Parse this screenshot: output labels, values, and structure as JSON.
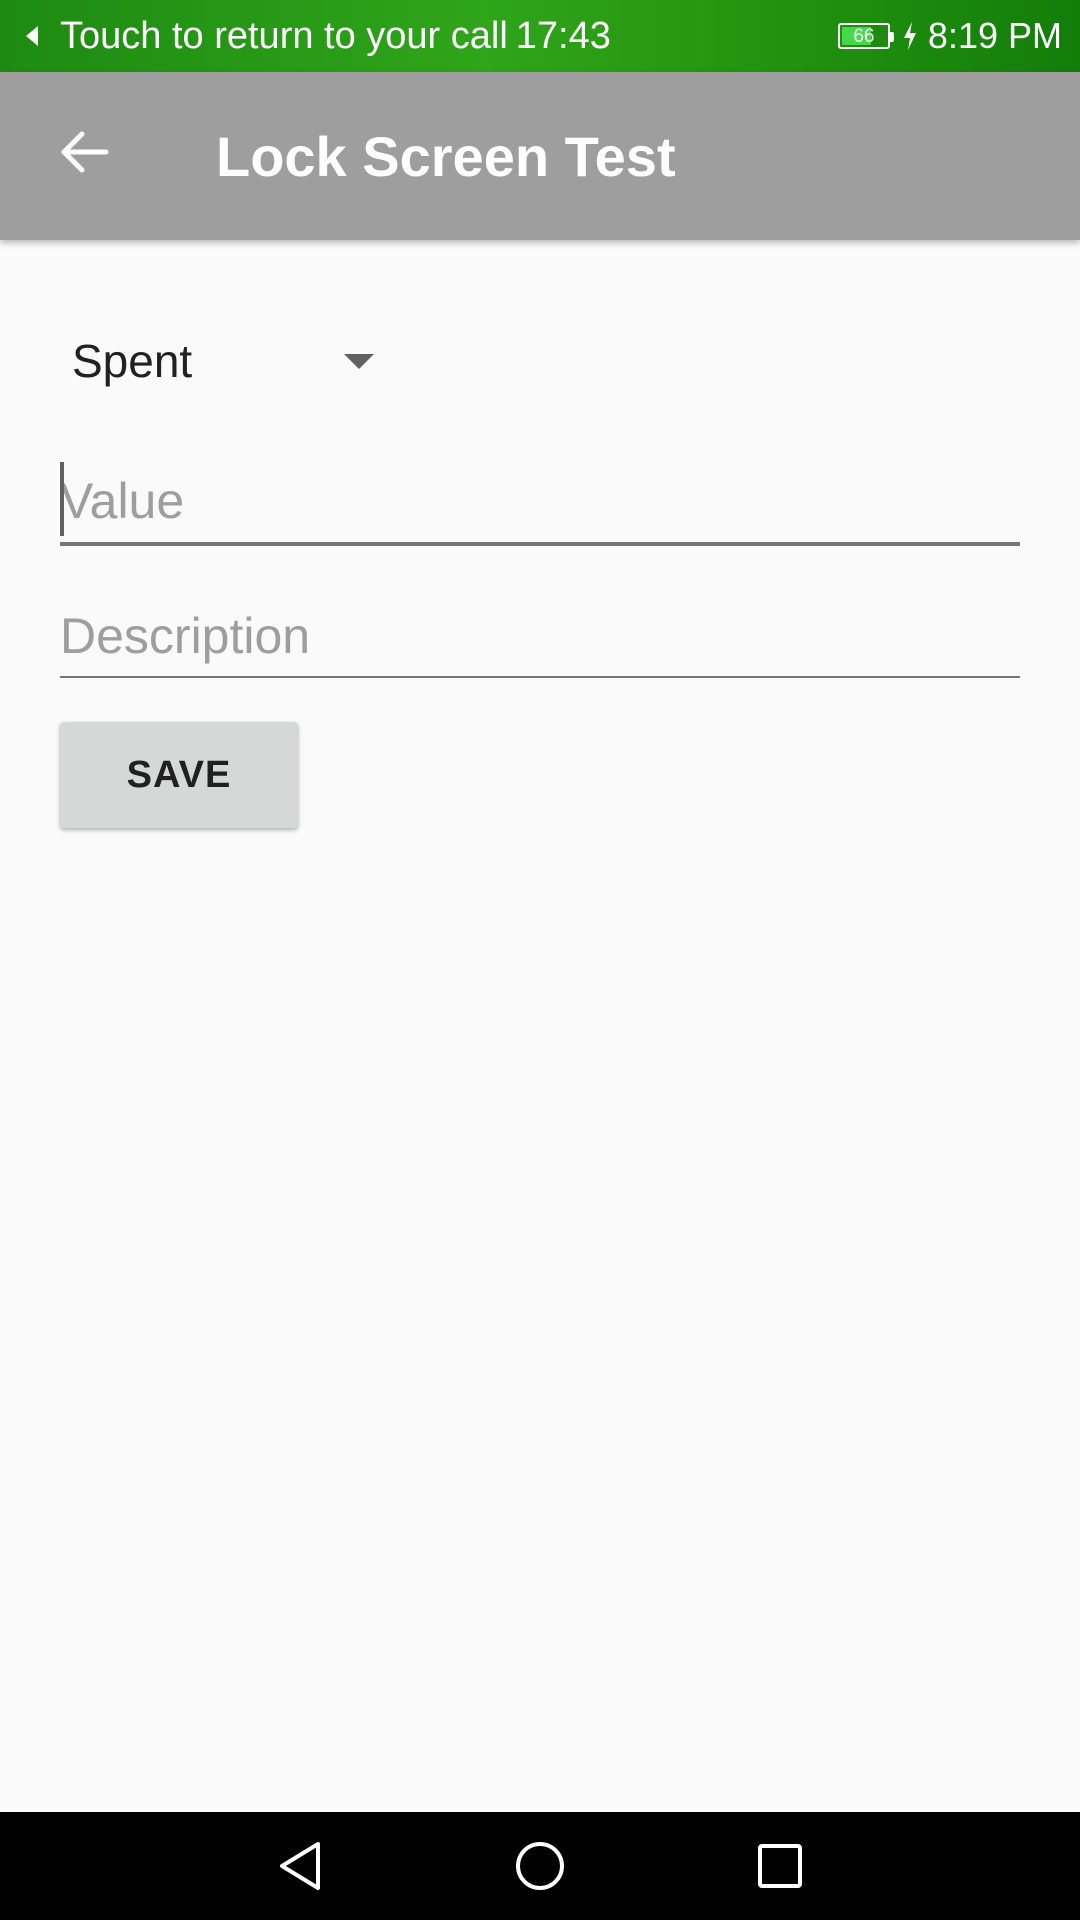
{
  "status_bar": {
    "call_text": "Touch to return to your call",
    "call_timer": "17:43",
    "battery_level": "66",
    "battery_fraction": 0.66,
    "clock": "8:19 PM",
    "icons": [
      "call-return-arrow-icon",
      "battery-icon",
      "charging-icon"
    ],
    "color": "#2fa51a"
  },
  "app_bar": {
    "title": "Lock Screen Test",
    "back_icon": "arrow-left-icon",
    "color": "#9e9e9e"
  },
  "form": {
    "spinner_value": "Spent",
    "value_placeholder": "Value",
    "value_text": "",
    "description_placeholder": "Description",
    "description_text": "",
    "save_label": "SAVE"
  },
  "nav_bar": {
    "icons": [
      "nav-back-icon",
      "nav-home-icon",
      "nav-recents-icon"
    ]
  }
}
